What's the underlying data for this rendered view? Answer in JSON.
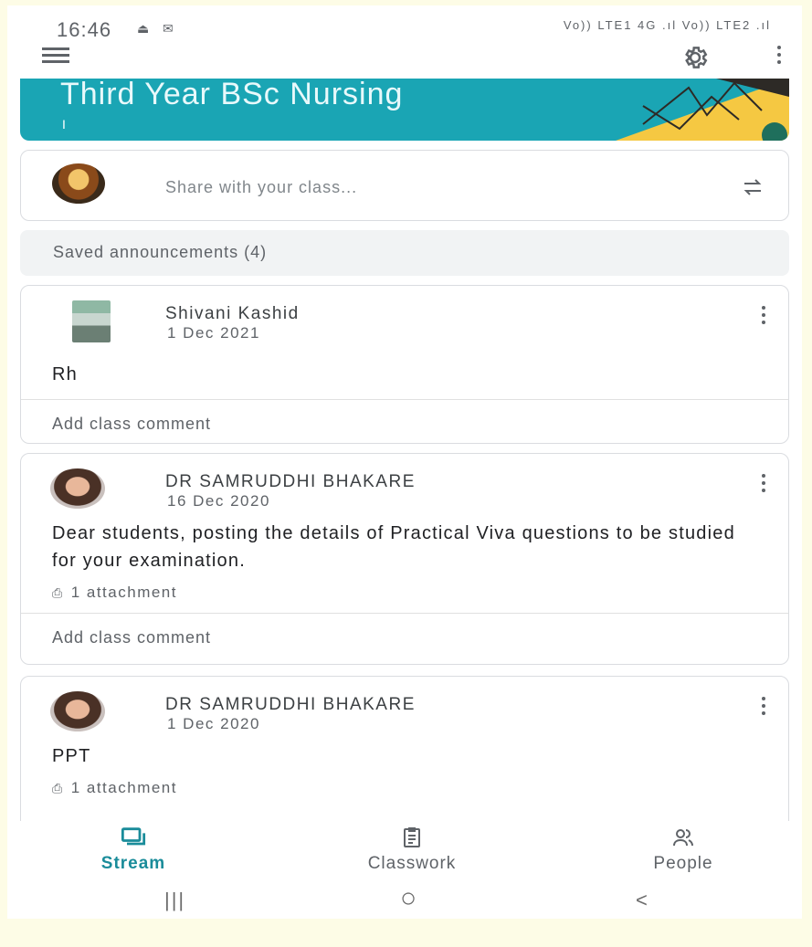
{
  "status_bar": {
    "time": "16:46",
    "indicators": "Vo)) LTE1 4G .ıl Vo)) LTE2 .ıl"
  },
  "app_bar": {
    "menu_icon": "hamburger-menu",
    "settings_icon": "gear",
    "more_icon": "vertical-dots"
  },
  "banner": {
    "title": "Third Year BSc Nursing",
    "subtitle": "I",
    "color": "#1aa5b4"
  },
  "share": {
    "placeholder": "Share with your class..."
  },
  "saved_announcements": {
    "label": "Saved announcements (4)"
  },
  "posts": [
    {
      "author": "Shivani Kashid",
      "date": "1 Dec 2021",
      "body": "Rh",
      "comment_placeholder": "Add class comment"
    },
    {
      "author": "DR SAMRUDDHI BHAKARE",
      "date": "16 Dec 2020",
      "body": "Dear students, posting the details of Practical Viva questions to be studied for your examination.",
      "attachment": "1 attachment",
      "comment_placeholder": "Add class comment"
    },
    {
      "author": "DR SAMRUDDHI BHAKARE",
      "date": "1 Dec 2020",
      "body": "PPT",
      "attachment": "1 attachment"
    }
  ],
  "bottom_nav": {
    "tabs": [
      {
        "label": "Stream",
        "icon": "stream-icon",
        "active": true
      },
      {
        "label": "Classwork",
        "icon": "classwork-icon",
        "active": false
      },
      {
        "label": "People",
        "icon": "people-icon",
        "active": false
      }
    ],
    "accent": "#1a8c9a"
  },
  "system_nav": {
    "recents": "|||",
    "home": "○",
    "back": "<"
  }
}
